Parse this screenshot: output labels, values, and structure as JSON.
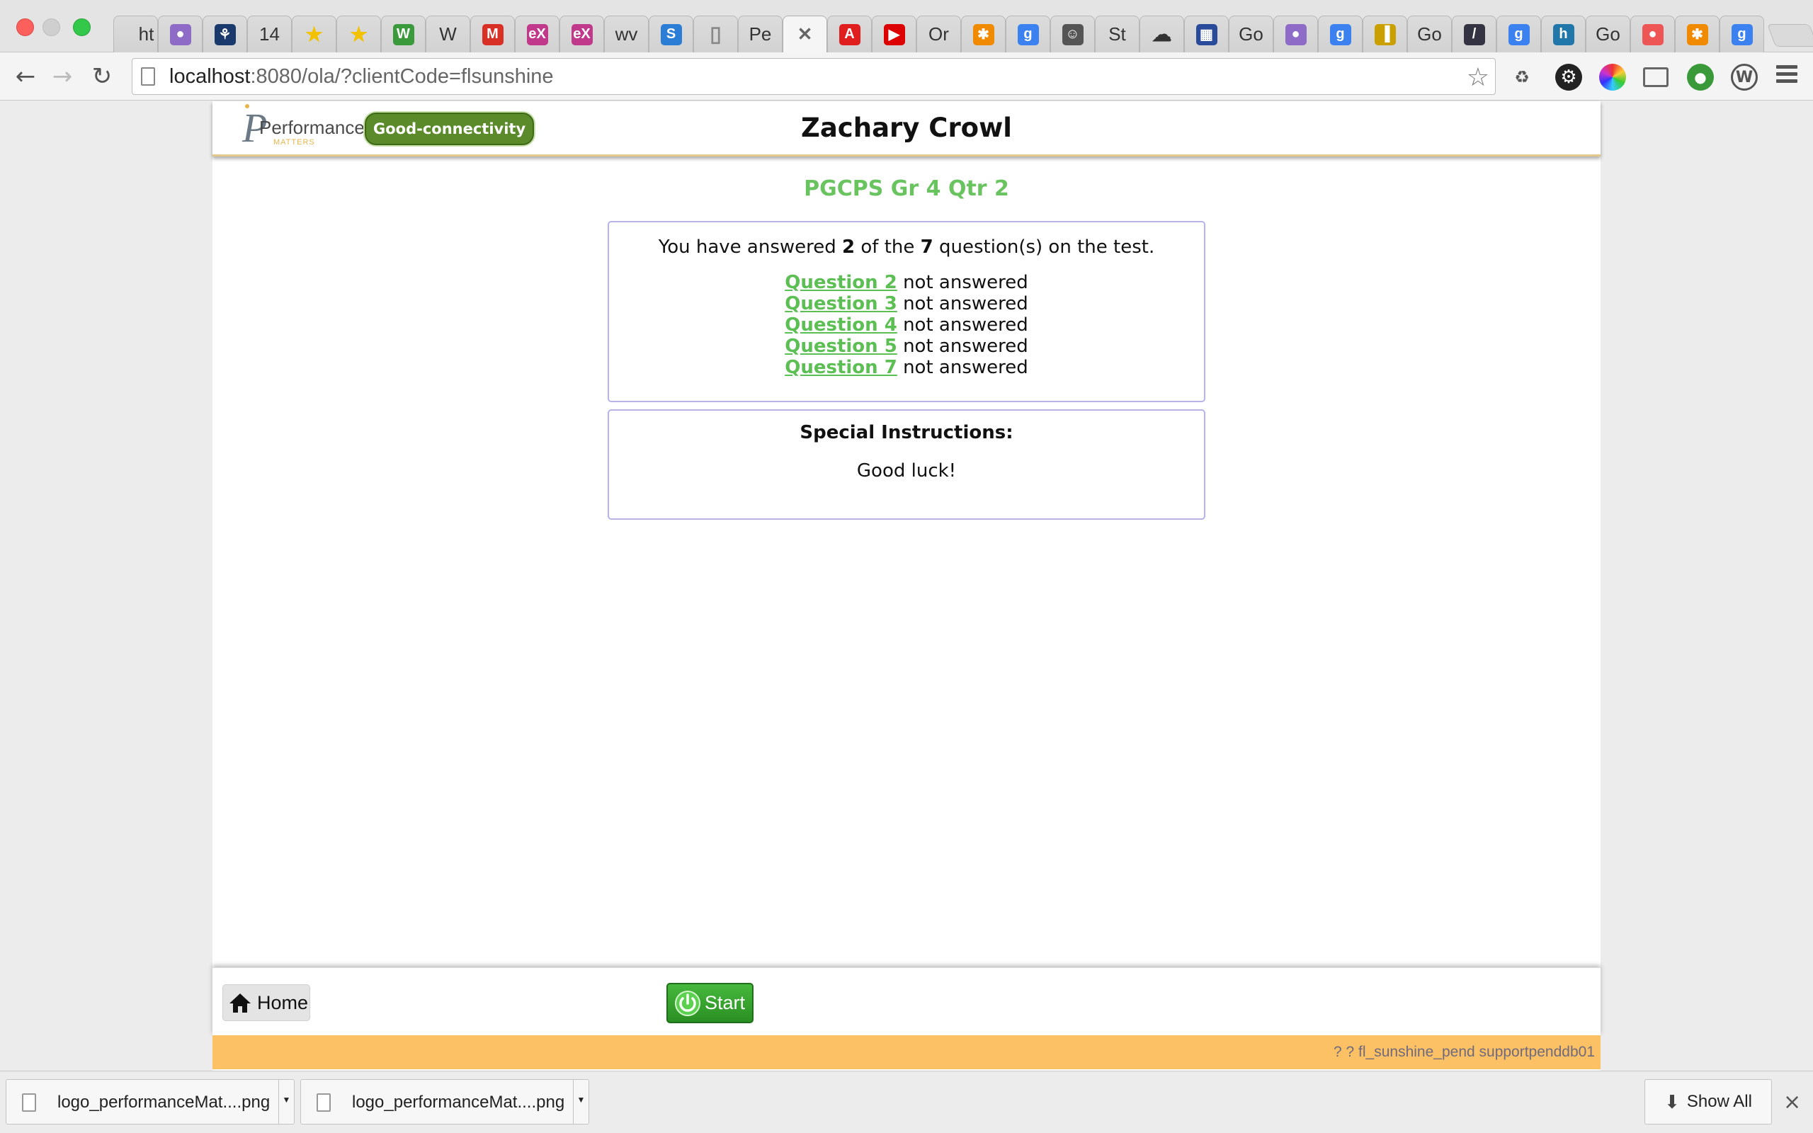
{
  "browser": {
    "tabs": [
      {
        "label": "ht",
        "icon": "page-text-icon",
        "color": ""
      },
      {
        "label": "",
        "icon": "circles-icon",
        "color": "#8e6bc7"
      },
      {
        "label": "",
        "icon": "figure-icon",
        "color": "#1a3a6e"
      },
      {
        "label": "14",
        "icon": "",
        "color": ""
      },
      {
        "label": "",
        "icon": "star-icon",
        "color": "#f2c200"
      },
      {
        "label": "",
        "icon": "star-icon",
        "color": "#f2c200"
      },
      {
        "label": "",
        "icon": "w-circle-icon",
        "color": "#3b9a3b"
      },
      {
        "label": "W",
        "icon": "",
        "color": ""
      },
      {
        "label": "",
        "icon": "gmail-icon",
        "color": "#d93025"
      },
      {
        "label": "",
        "icon": "edx-icon",
        "color": "#c0398b"
      },
      {
        "label": "",
        "icon": "edx-icon",
        "color": "#c0398b"
      },
      {
        "label": "wv",
        "icon": "",
        "color": ""
      },
      {
        "label": "",
        "icon": "s-logo-icon",
        "color": "#2b7dd6"
      },
      {
        "label": "",
        "icon": "blank-page-icon",
        "color": ""
      },
      {
        "label": "Pe",
        "icon": "",
        "color": ""
      },
      {
        "label": "",
        "icon": "close-icon",
        "color": ""
      },
      {
        "label": "",
        "icon": "adobe-icon",
        "color": "#e01e1e"
      },
      {
        "label": "",
        "icon": "youtube-icon",
        "color": "#d00"
      },
      {
        "label": "Or",
        "icon": "",
        "color": ""
      },
      {
        "label": "",
        "icon": "asterisk-icon",
        "color": "#f08a00"
      },
      {
        "label": "",
        "icon": "google-icon",
        "color": "#3b82f0"
      },
      {
        "label": "",
        "icon": "avatar-icon",
        "color": "#555"
      },
      {
        "label": "St",
        "icon": "",
        "color": ""
      },
      {
        "label": "",
        "icon": "cloud-icon",
        "color": "#333"
      },
      {
        "label": "",
        "icon": "grid-icon",
        "color": "#2a4a9a"
      },
      {
        "label": "Go",
        "icon": "",
        "color": ""
      },
      {
        "label": "",
        "icon": "circles-icon",
        "color": "#8e6bc7"
      },
      {
        "label": "",
        "icon": "google-icon",
        "color": "#3b82f0"
      },
      {
        "label": "",
        "icon": "books-icon",
        "color": "#c9a000"
      },
      {
        "label": "Go",
        "icon": "",
        "color": ""
      },
      {
        "label": "",
        "icon": "slash-icon",
        "color": "#334"
      },
      {
        "label": "",
        "icon": "google-icon",
        "color": "#3b82f0"
      },
      {
        "label": "",
        "icon": "hm-icon",
        "color": "#27a"
      },
      {
        "label": "Go",
        "icon": "",
        "color": ""
      },
      {
        "label": "",
        "icon": "color-wheel-icon",
        "color": "#e55"
      },
      {
        "label": "",
        "icon": "asterisk-icon",
        "color": "#f08a00"
      },
      {
        "label": "",
        "icon": "google-icon",
        "color": "#3b82f0"
      }
    ],
    "url_host": "localhost",
    "url_rest": ":8080/ola/?clientCode=flsunshine"
  },
  "header": {
    "logo_text": "Performance",
    "logo_subtext": "MATTERS",
    "connectivity": "Good-connectivity",
    "student_name": "Zachary Crowl"
  },
  "main": {
    "test_title": "PGCPS Gr 4 Qtr 2",
    "summary": {
      "prefix": "You have answered ",
      "answered": "2",
      "middle": " of the ",
      "total": "7",
      "suffix": " question(s) on the test."
    },
    "unanswered": [
      {
        "link": "Question 2",
        "status": " not answered"
      },
      {
        "link": "Question 3",
        "status": " not answered"
      },
      {
        "link": "Question 4",
        "status": " not answered"
      },
      {
        "link": "Question 5",
        "status": " not answered"
      },
      {
        "link": "Question 7",
        "status": " not answered"
      }
    ],
    "instructions_title": "Special Instructions:",
    "instructions_text": "Good luck!"
  },
  "footer": {
    "home_label": "Home",
    "start_label": "Start",
    "status_text": "? ? fl_sunshine_pend supportpenddb01"
  },
  "downloads": {
    "items": [
      {
        "name": "logo_performanceMat....png"
      },
      {
        "name": "logo_performanceMat....png"
      }
    ],
    "show_all": "Show All"
  },
  "colors": {
    "accent_green": "#69c460",
    "connectivity_badge": "#5b8a2a",
    "status_bar": "#fbc164",
    "box_border": "#b7b3e6"
  }
}
